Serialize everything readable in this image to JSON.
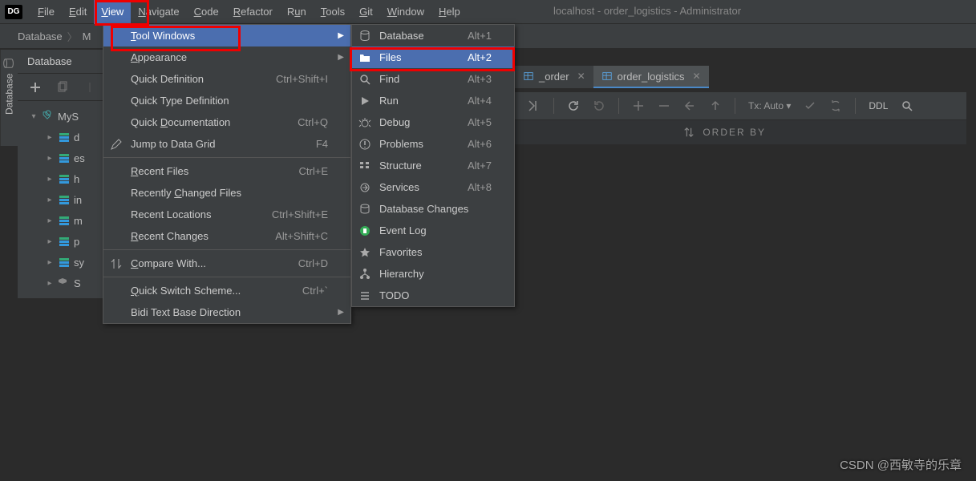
{
  "menubar": {
    "logo": "DG",
    "items": [
      {
        "label": "File",
        "mn": "F"
      },
      {
        "label": "Edit",
        "mn": "E"
      },
      {
        "label": "View",
        "mn": "V",
        "active": true
      },
      {
        "label": "Navigate",
        "mn": "N"
      },
      {
        "label": "Code",
        "mn": "C"
      },
      {
        "label": "Refactor",
        "mn": "R"
      },
      {
        "label": "Run",
        "mn": "u",
        "pre": "R"
      },
      {
        "label": "Tools",
        "mn": "T"
      },
      {
        "label": "Git",
        "mn": "G"
      },
      {
        "label": "Window",
        "mn": "W"
      },
      {
        "label": "Help",
        "mn": "H"
      }
    ],
    "title": "localhost - order_logistics - Administrator"
  },
  "breadcrumb": {
    "items": [
      "Database",
      "M"
    ]
  },
  "side_tab": {
    "label": "Database"
  },
  "db_panel": {
    "title": "Database"
  },
  "db_tree": {
    "root": "MyS",
    "children": [
      "d",
      "es",
      "h",
      "in",
      "m",
      "p",
      "sy",
      "S"
    ]
  },
  "view_menu": {
    "items": [
      {
        "label": "Tool Windows",
        "mn": "T",
        "arrow": true,
        "sel": true
      },
      {
        "label": "Appearance",
        "mn": "A",
        "arrow": true
      },
      {
        "label": "Quick Definition",
        "shortcut": "Ctrl+Shift+I"
      },
      {
        "label": "Quick Type Definition"
      },
      {
        "label": "Quick Documentation",
        "mn": "D",
        "shortcut": "Ctrl+Q"
      },
      {
        "label": "Jump to Data Grid",
        "shortcut": "F4",
        "icon": "pencil"
      },
      {
        "sep": true
      },
      {
        "label": "Recent Files",
        "mn": "R",
        "shortcut": "Ctrl+E"
      },
      {
        "label": "Recently Changed Files",
        "mn": "C"
      },
      {
        "label": "Recent Locations",
        "shortcut": "Ctrl+Shift+E"
      },
      {
        "label": "Recent Changes",
        "mn": "R",
        "shortcut": "Alt+Shift+C"
      },
      {
        "sep": true
      },
      {
        "label": "Compare With...",
        "mn": "C",
        "shortcut": "Ctrl+D",
        "icon": "compare"
      },
      {
        "sep": true
      },
      {
        "label": "Quick Switch Scheme...",
        "mn": "Q",
        "shortcut": "Ctrl+`"
      },
      {
        "label": "Bidi Text Base Direction",
        "arrow": true
      }
    ]
  },
  "tool_windows_menu": {
    "items": [
      {
        "label": "Database",
        "shortcut": "Alt+1",
        "icon": "database"
      },
      {
        "label": "Files",
        "shortcut": "Alt+2",
        "icon": "folder",
        "sel": true
      },
      {
        "label": "Find",
        "shortcut": "Alt+3",
        "icon": "search"
      },
      {
        "label": "Run",
        "shortcut": "Alt+4",
        "icon": "play"
      },
      {
        "label": "Debug",
        "shortcut": "Alt+5",
        "icon": "bug"
      },
      {
        "label": "Problems",
        "shortcut": "Alt+6",
        "icon": "problems"
      },
      {
        "label": "Structure",
        "shortcut": "Alt+7",
        "icon": "structure"
      },
      {
        "label": "Services",
        "shortcut": "Alt+8",
        "icon": "services"
      },
      {
        "label": "Database Changes",
        "icon": "dbchanges"
      },
      {
        "label": "Event Log",
        "icon": "eventlog"
      },
      {
        "label": "Favorites",
        "icon": "star"
      },
      {
        "label": "Hierarchy",
        "icon": "hierarchy"
      },
      {
        "label": "TODO",
        "icon": "todo"
      }
    ]
  },
  "tabs": [
    {
      "label": "_order",
      "partial": true
    },
    {
      "label": "order_logistics",
      "active": true
    }
  ],
  "ed_toolbar": {
    "txauto": "Tx: Auto",
    "ddl": "DDL"
  },
  "sort": {
    "label": "ORDER BY"
  },
  "watermark": "CSDN @西敏寺的乐章"
}
